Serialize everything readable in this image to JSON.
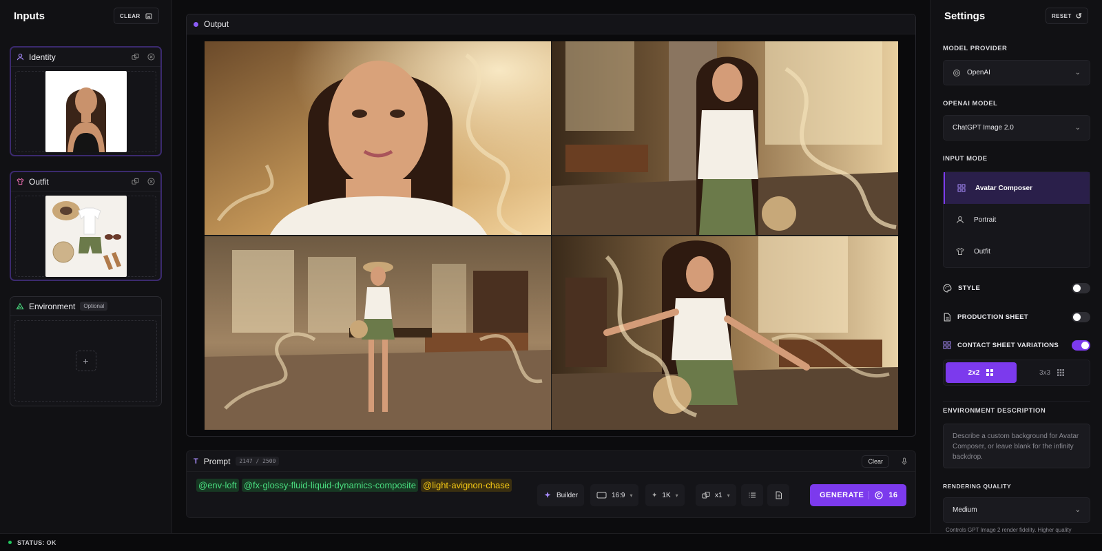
{
  "inputs": {
    "title": "Inputs",
    "clear_label": "CLEAR",
    "cards": [
      {
        "label": "Identity"
      },
      {
        "label": "Outfit"
      },
      {
        "label": "Environment",
        "tag": "Optional"
      }
    ]
  },
  "output": {
    "title": "Output"
  },
  "prompt": {
    "title": "Prompt",
    "counter": "2147 / 2500",
    "clear_label": "Clear",
    "tokens": [
      {
        "text": "@env-loft",
        "color": "green"
      },
      {
        "text": "@fx-glossy-fluid-liquid-dynamics-composite",
        "color": "green"
      },
      {
        "text": "@light-avignon-chase",
        "color": "yellow"
      }
    ]
  },
  "toolbar": {
    "builder_label": "Builder",
    "aspect": "16:9",
    "resolution": "1K",
    "count": "x1",
    "generate_label": "GENERATE",
    "credits": "16"
  },
  "settings": {
    "title": "Settings",
    "reset_label": "RESET",
    "model_provider_label": "MODEL PROVIDER",
    "model_provider": "OpenAI",
    "model_label": "OPENAI MODEL",
    "model": "ChatGPT Image 2.0",
    "input_mode_label": "INPUT MODE",
    "modes": [
      "Avatar Composer",
      "Portrait",
      "Outfit"
    ],
    "active_mode": "Avatar Composer",
    "style_label": "STYLE",
    "style_on": false,
    "production_label": "PRODUCTION SHEET",
    "production_on": false,
    "contact_label": "CONTACT SHEET VARIATIONS",
    "contact_on": true,
    "grid_options": [
      "2x2",
      "3x3"
    ],
    "grid_selected": "2x2",
    "env_desc_label": "ENVIRONMENT DESCRIPTION",
    "env_desc_placeholder": "Describe a custom background for Avatar Composer, or leave blank for the infinity backdrop.",
    "quality_label": "RENDERING QUALITY",
    "quality": "Medium",
    "quality_hint": "Controls GPT Image 2 render fidelity. Higher quality"
  },
  "status": {
    "text": "STATUS: OK"
  },
  "colors": {
    "accent": "#7c3aed",
    "token_green": "#4ade80",
    "token_yellow": "#facc15",
    "status_ok": "#22c55e"
  }
}
